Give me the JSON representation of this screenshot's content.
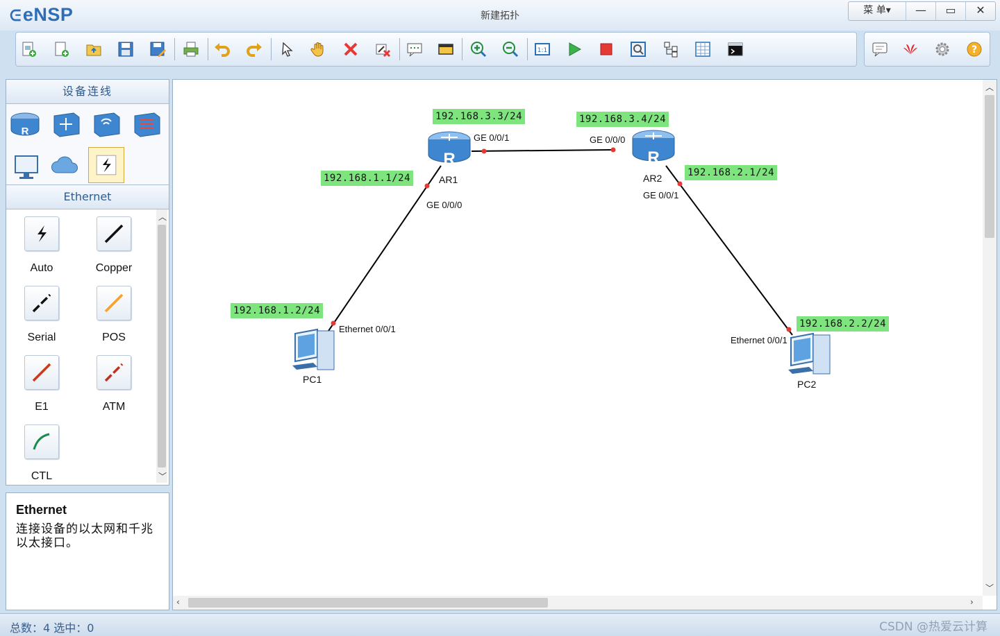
{
  "app": {
    "logo": "eNSP",
    "window_title": "新建拓扑",
    "menu_label": "菜 单▾",
    "min_glyph": "—",
    "max_glyph": "▭",
    "close_glyph": "✕"
  },
  "toolbar": {
    "icons": [
      "new-topology-icon",
      "new-lab-icon",
      "open-icon",
      "save-icon",
      "save-as-icon",
      "print-icon",
      "undo-icon",
      "redo-icon",
      "select-icon",
      "pan-hand-icon",
      "delete-icon",
      "delete-links-icon",
      "add-note-icon",
      "palette-icon",
      "zoom-in-icon",
      "zoom-out-icon",
      "fit-view-icon",
      "start-device-icon",
      "stop-device-icon",
      "capture-icon",
      "topology-tree-icon",
      "grid-icon",
      "console-icon"
    ],
    "right_icons": [
      "chat-icon",
      "huawei-logo-icon",
      "settings-icon",
      "help-icon"
    ]
  },
  "left_panel": {
    "title": "设备连线",
    "devices": [
      "router-icon",
      "switch-icon",
      "wireless-icon",
      "firewall-icon",
      "pc-icon",
      "cloud-icon",
      "connection-icon"
    ],
    "section_title": "Ethernet",
    "cables": [
      {
        "label": "Auto",
        "icon": "auto-cable-icon",
        "color": "#111111"
      },
      {
        "label": "Copper",
        "icon": "copper-cable-icon",
        "color": "#111111"
      },
      {
        "label": "Serial",
        "icon": "serial-cable-icon",
        "color": "#111111"
      },
      {
        "label": "POS",
        "icon": "pos-cable-icon",
        "color": "#f5a030"
      },
      {
        "label": "E1",
        "icon": "e1-cable-icon",
        "color": "#c83a1c"
      },
      {
        "label": "ATM",
        "icon": "atm-cable-icon",
        "color": "#b8341e"
      },
      {
        "label": "CTL",
        "icon": "ctl-cable-icon",
        "color": "#1c8a4c"
      }
    ]
  },
  "description": {
    "title": "Ethernet",
    "text": "连接设备的以太网和千兆以太接口。"
  },
  "topology": {
    "devices": [
      {
        "name": "AR1",
        "type": "router"
      },
      {
        "name": "AR2",
        "type": "router"
      },
      {
        "name": "PC1",
        "type": "pc"
      },
      {
        "name": "PC2",
        "type": "pc"
      }
    ],
    "ip_labels": [
      "192.168.3.3/24",
      "192.168.3.4/24",
      "192.168.1.1/24",
      "192.168.2.1/24",
      "192.168.1.2/24",
      "192.168.2.2/24"
    ],
    "ports": [
      "GE 0/0/1",
      "GE 0/0/0",
      "GE 0/0/0",
      "GE 0/0/1",
      "Ethernet 0/0/1",
      "Ethernet 0/0/1"
    ],
    "link_color": "#000000",
    "port_dot_color": "#e53935",
    "ip_label_color": "#7ee47e"
  },
  "statusbar": {
    "text": "总数：4  选中：0",
    "watermark": "CSDN @热爱云计算"
  }
}
